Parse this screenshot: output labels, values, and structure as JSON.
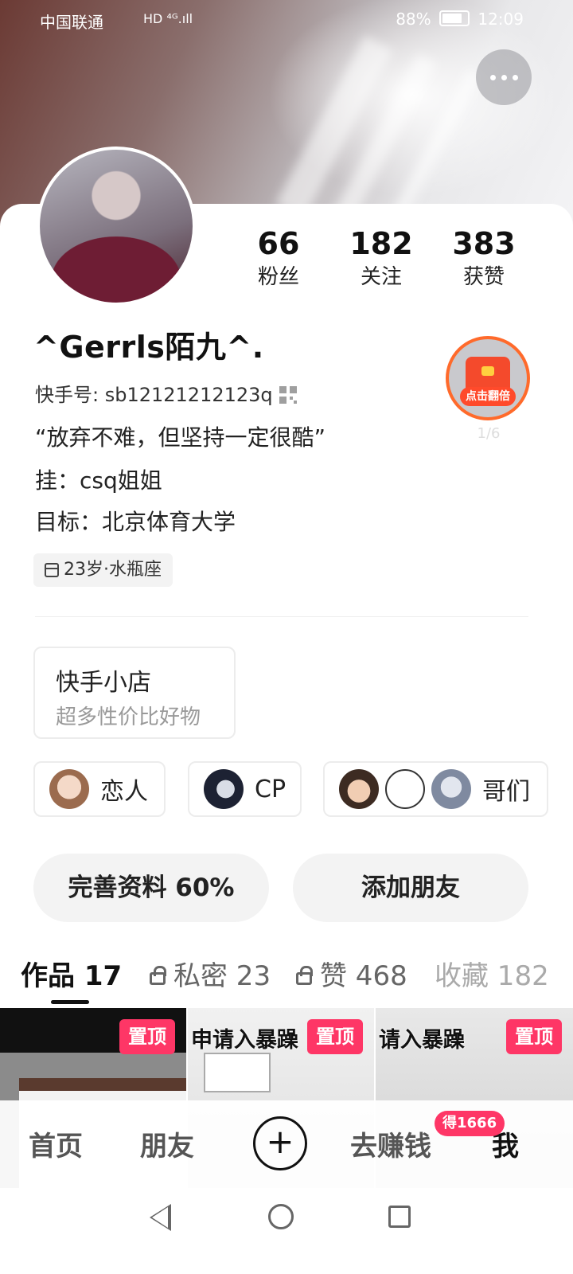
{
  "status_bar": {
    "carrier": "中国联通",
    "network": "HD ⁴ᴳ.ıll",
    "battery": "88%",
    "time": "12:09"
  },
  "profile": {
    "name": "^Gerrls陌九^.",
    "kuaishou_id": "快手号: sb12121212123q",
    "bio_lines": [
      "“放弃不难，但坚持一定很酷”",
      "挂：csq姐姐",
      "目标：北京体育大学"
    ],
    "tag": "23岁·水瓶座"
  },
  "stats": [
    {
      "value": "66",
      "label": "粉丝"
    },
    {
      "value": "182",
      "label": "关注"
    },
    {
      "value": "383",
      "label": "获赞"
    }
  ],
  "red_packet": {
    "label": "点击翻倍",
    "count": "1/6"
  },
  "shop": {
    "title": "快手小店",
    "subtitle": "超多性价比好物"
  },
  "relations": [
    {
      "label": "恋人"
    },
    {
      "label": "CP"
    },
    {
      "label": "哥们"
    }
  ],
  "actions": {
    "complete_profile": "完善资料 60%",
    "add_friend": "添加朋友"
  },
  "tabs": [
    {
      "label": "作品 17"
    },
    {
      "label": "私密 23"
    },
    {
      "label": "赞 468"
    },
    {
      "label": "收藏 182"
    }
  ],
  "thumbnails": [
    {
      "badge": "置顶",
      "caption": ""
    },
    {
      "badge": "置顶",
      "caption": "申请入暴躁"
    },
    {
      "badge": "置顶",
      "caption": "请入暴躁"
    }
  ],
  "bottom_nav": {
    "home": "首页",
    "friends": "朋友",
    "earn": "去赚钱",
    "earn_badge": "得1666",
    "me": "我",
    "plus": "+"
  }
}
